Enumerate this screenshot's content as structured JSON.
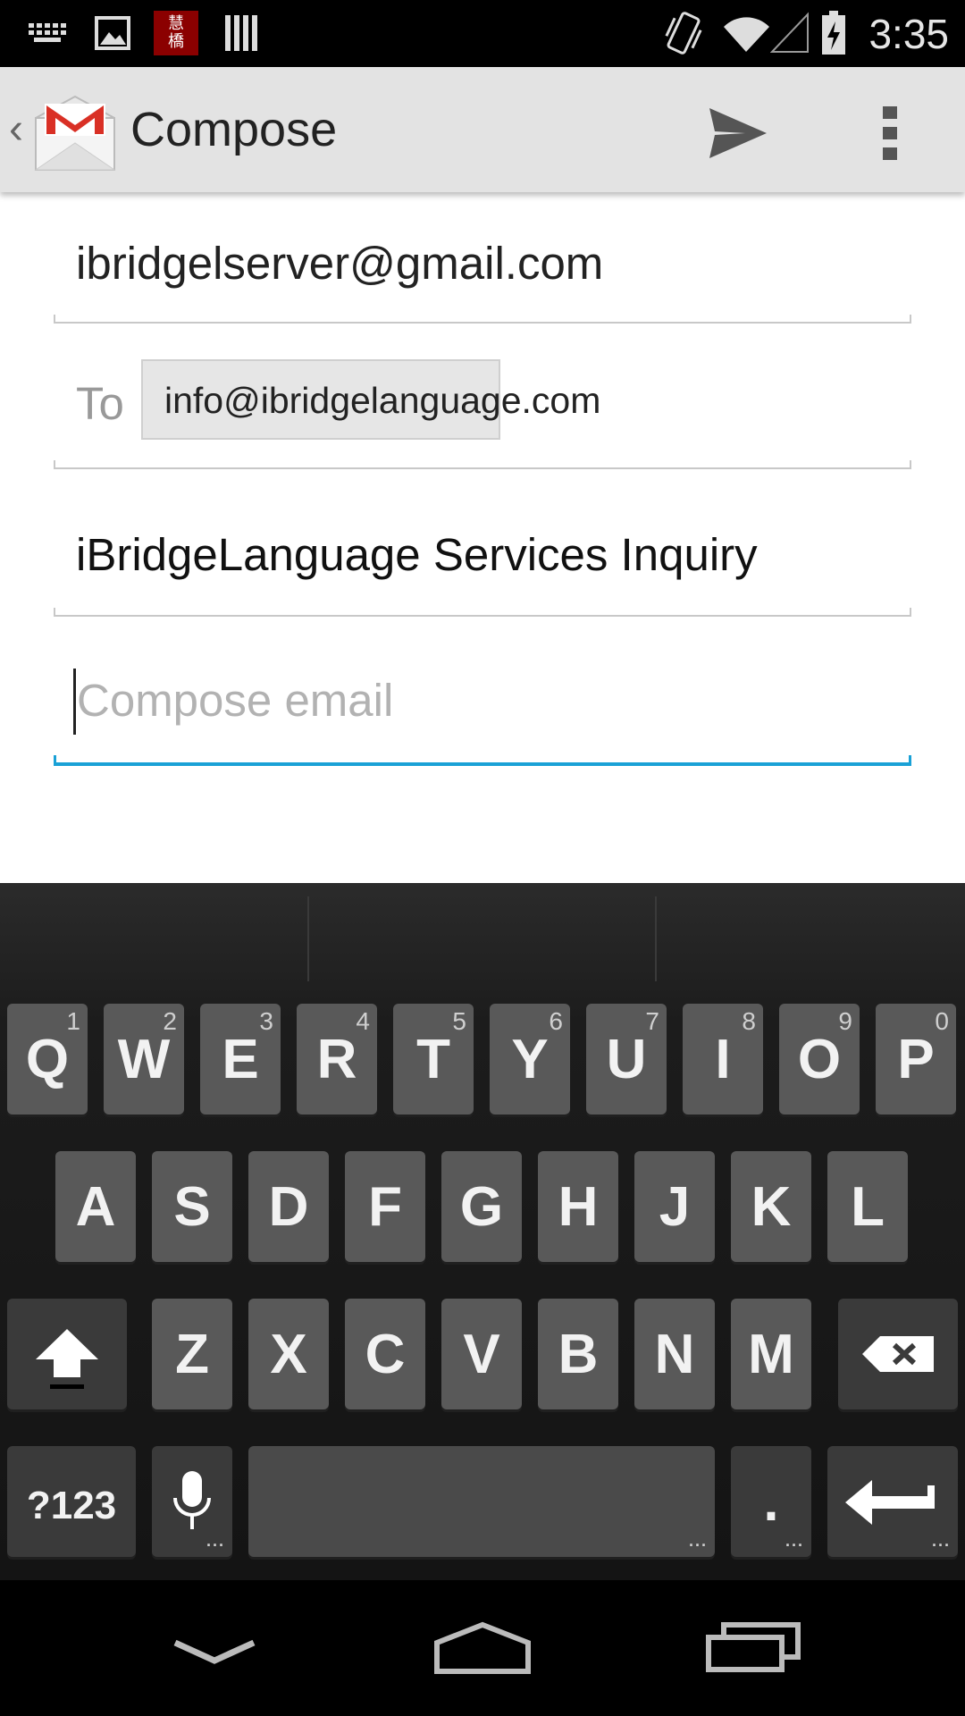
{
  "status_bar": {
    "time": "3:35",
    "notification_icons": [
      "keyboard-icon",
      "image-icon",
      "ibridge-app-icon",
      "barcode-icon"
    ],
    "system_icons": [
      "vibrate-icon",
      "wifi-icon",
      "signal-icon",
      "battery-charging-icon"
    ],
    "app_icon_glyph": "慧橋"
  },
  "action_bar": {
    "title": "Compose",
    "logo": "gmail-icon",
    "actions": [
      "send-icon",
      "overflow-menu-icon"
    ]
  },
  "form": {
    "from": "ibridgelserver@gmail.com",
    "to_label": "To",
    "to_chip": "info@ibridgelanguage.com",
    "subject": "iBridgeLanguage Services Inquiry",
    "body_placeholder": "Compose email",
    "focused_field": "body"
  },
  "colors": {
    "focus_accent": "#1aa1d6",
    "gmail_red": "#d93025"
  },
  "keyboard": {
    "row1": [
      {
        "key": "Q",
        "sub": "1"
      },
      {
        "key": "W",
        "sub": "2"
      },
      {
        "key": "E",
        "sub": "3"
      },
      {
        "key": "R",
        "sub": "4"
      },
      {
        "key": "T",
        "sub": "5"
      },
      {
        "key": "Y",
        "sub": "6"
      },
      {
        "key": "U",
        "sub": "7"
      },
      {
        "key": "I",
        "sub": "8"
      },
      {
        "key": "O",
        "sub": "9"
      },
      {
        "key": "P",
        "sub": "0"
      }
    ],
    "row2": [
      "A",
      "S",
      "D",
      "F",
      "G",
      "H",
      "J",
      "K",
      "L"
    ],
    "row3": [
      "Z",
      "X",
      "C",
      "V",
      "B",
      "N",
      "M"
    ],
    "symbols_label": "?123",
    "period_label": ".",
    "special_keys": [
      "shift-icon",
      "backspace-icon",
      "microphone-icon",
      "space",
      "enter-icon"
    ]
  },
  "nav_bar": [
    "back-icon",
    "home-icon",
    "recent-apps-icon"
  ]
}
